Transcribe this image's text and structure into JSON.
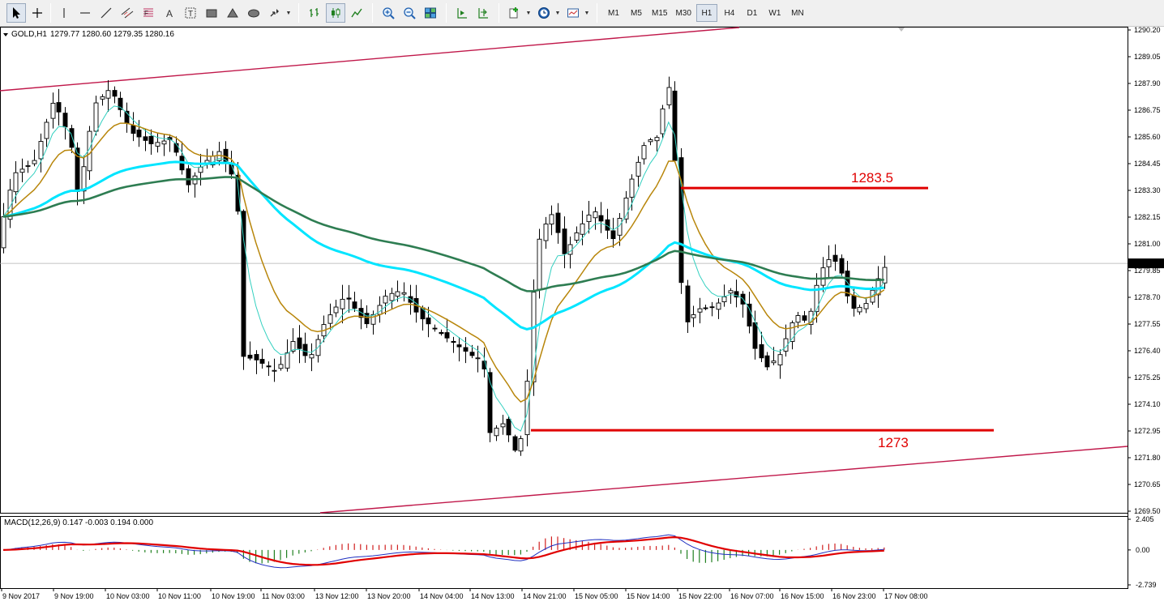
{
  "toolbar": {
    "tools": [
      {
        "name": "cursor-tool",
        "icon": "cursor-arrow-icon",
        "active": true
      },
      {
        "name": "crosshair-tool",
        "icon": "crosshair-icon"
      },
      {
        "name": "vertical-line-tool",
        "icon": "vertical-line-icon"
      },
      {
        "name": "horizontal-line-tool",
        "icon": "horizontal-line-icon"
      },
      {
        "name": "trendline-tool",
        "icon": "trendline-icon"
      },
      {
        "name": "equidistant-channel-tool",
        "icon": "channel-icon"
      },
      {
        "name": "fibonacci-tool",
        "icon": "fibonacci-icon"
      },
      {
        "name": "text-tool",
        "icon": "text-icon",
        "label": "A"
      },
      {
        "name": "text-label-tool",
        "icon": "text-label-icon",
        "label": "T"
      },
      {
        "name": "rectangle-tool",
        "icon": "rectangle-icon"
      },
      {
        "name": "triangle-tool",
        "icon": "triangle-icon"
      },
      {
        "name": "ellipse-tool",
        "icon": "ellipse-icon"
      },
      {
        "name": "arrows-tool",
        "icon": "arrows-icon"
      }
    ],
    "chart_types": [
      {
        "name": "bar-chart-button",
        "icon": "bar-chart-icon"
      },
      {
        "name": "candlestick-chart-button",
        "icon": "candlestick-icon",
        "active": true
      },
      {
        "name": "line-chart-button",
        "icon": "line-chart-icon"
      }
    ],
    "zoom": [
      {
        "name": "zoom-in-button",
        "icon": "zoom-in-icon"
      },
      {
        "name": "zoom-out-button",
        "icon": "zoom-out-icon"
      },
      {
        "name": "tile-windows-button",
        "icon": "tile-windows-icon"
      }
    ],
    "nav": [
      {
        "name": "auto-scroll-button",
        "icon": "auto-scroll-icon"
      },
      {
        "name": "chart-shift-button",
        "icon": "chart-shift-icon"
      }
    ],
    "extras": [
      {
        "name": "indicators-button",
        "icon": "indicators-icon"
      },
      {
        "name": "periods-button",
        "icon": "clock-icon"
      },
      {
        "name": "templates-button",
        "icon": "templates-icon"
      }
    ],
    "timeframes": [
      "M1",
      "M5",
      "M15",
      "M30",
      "H1",
      "H4",
      "D1",
      "W1",
      "MN"
    ],
    "active_timeframe": "H1"
  },
  "chart": {
    "symbol_title": "GOLD,H1",
    "ohlc_readout": "1279.77 1280.60 1279.35 1280.16",
    "current_price_label": "1280.16",
    "price_ticks": [
      "1290.20",
      "1289.05",
      "1287.90",
      "1286.75",
      "1285.60",
      "1284.45",
      "1283.30",
      "1282.15",
      "1281.00",
      "1279.85",
      "1278.70",
      "1277.55",
      "1276.40",
      "1275.25",
      "1274.10",
      "1272.95",
      "1271.80",
      "1270.65",
      "1269.50"
    ],
    "time_ticks": [
      "9 Nov 2017",
      "9 Nov 19:00",
      "10 Nov 03:00",
      "10 Nov 11:00",
      "10 Nov 19:00",
      "11 Nov 03:00",
      "13 Nov 12:00",
      "13 Nov 20:00",
      "14 Nov 04:00",
      "14 Nov 13:00",
      "14 Nov 21:00",
      "15 Nov 05:00",
      "15 Nov 14:00",
      "15 Nov 22:00",
      "16 Nov 07:00",
      "16 Nov 15:00",
      "16 Nov 23:00",
      "17 Nov 08:00"
    ],
    "levels": [
      {
        "name": "resistance-level",
        "value": 1283.4,
        "label": "1283.5",
        "color": "#e00000"
      },
      {
        "name": "support-level",
        "value": 1272.98,
        "label": "1273",
        "color": "#e00000"
      }
    ],
    "colors": {
      "bull_body": "#ffffff",
      "bear_body": "#000000",
      "channel": "#c0184a",
      "ma_fast": "#33d0c0",
      "ma_mid": "#b8860b",
      "ma_slow_cyan": "#00e5ff",
      "ma_slow_green": "#2e7d52"
    }
  },
  "macd": {
    "title": "MACD(12,26,9) 0.147 -0.003 0.194 0.000",
    "ticks": [
      "2.405",
      "0.00",
      "-2.739"
    ],
    "colors": {
      "macd_line": "#1e2fc0",
      "signal_line": "#e00000",
      "hist_up": "#d02020",
      "hist_down": "#208020"
    }
  }
}
